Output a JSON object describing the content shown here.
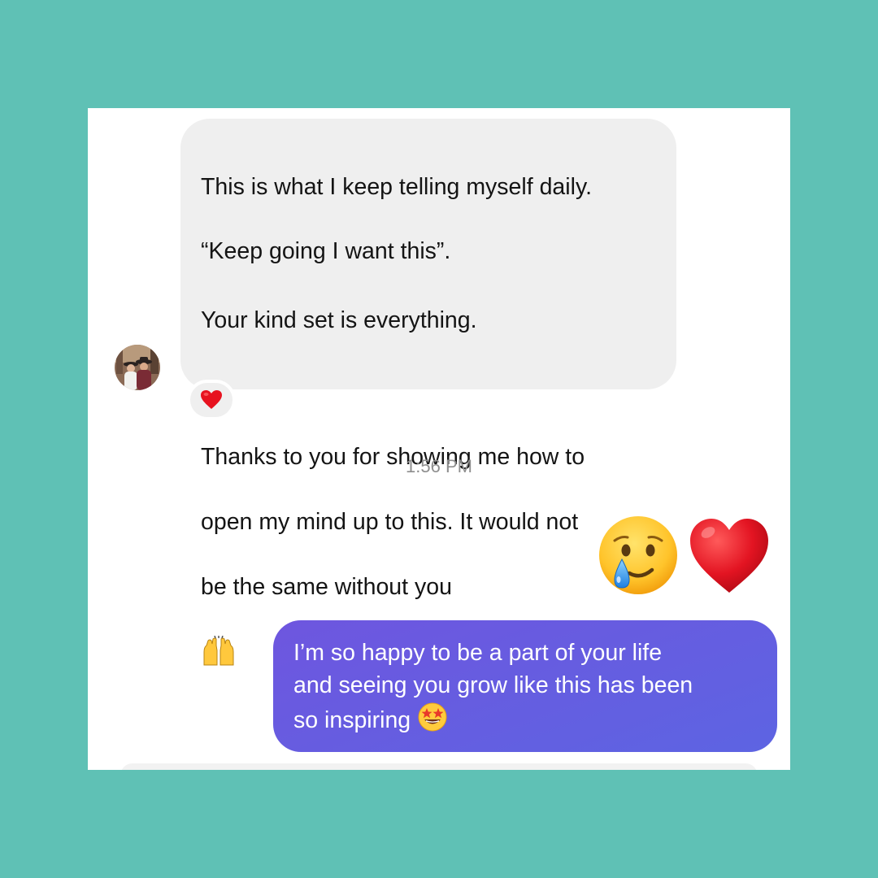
{
  "colors": {
    "background": "#5fc1b5",
    "card": "#ffffff",
    "incoming_bubble": "#efefef",
    "outgoing_bubble_start": "#6e56df",
    "outgoing_bubble_end": "#5d64e2",
    "timestamp": "#8e8e8e"
  },
  "incoming_message": {
    "line1": "This is what I keep telling myself daily.",
    "line2": "“Keep going I want this”.",
    "line3": "Your kind set is everything.",
    "line4": "Thanks to you for showing me how to",
    "line5": "open my mind up to this. It would not",
    "line6": "be the same without you",
    "trailing_emoji": "raised-hands-icon",
    "reaction": "red-heart-icon"
  },
  "timestamp": "1:56 PM",
  "emoji_reply": [
    "smiling-face-with-tear-icon",
    "red-heart-icon"
  ],
  "outgoing_message": {
    "line1": "I’m so happy to be a part of your life",
    "line2": "and seeing you grow like this has been",
    "line3": "so inspiring",
    "trailing_emoji": "star-struck-icon"
  }
}
